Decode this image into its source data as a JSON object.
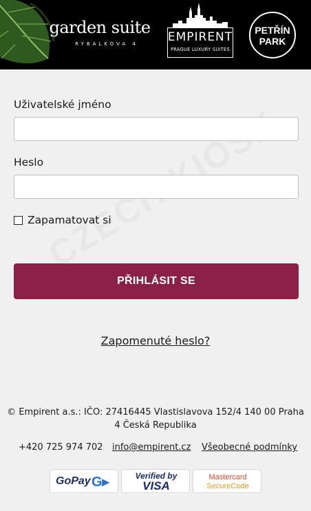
{
  "header": {
    "garden_suite": {
      "name": "garden suite",
      "sub": "RYBALKOVA 4"
    },
    "empirent": {
      "title": "EMPIRENT",
      "tagline": "PRAGUE LUXURY SUITES"
    },
    "petrin": {
      "line1": "PETŘÍN",
      "line2": "PARK"
    }
  },
  "watermark": "CZECH KIOSK",
  "form": {
    "username_label": "Uživatelské jméno",
    "username_value": "",
    "password_label": "Heslo",
    "password_value": "",
    "remember_label": "Zapamatovat si",
    "remember_checked": false,
    "login_button": "PŘIHLÁSIT SE",
    "forgot_link": "Zapomenuté heslo?"
  },
  "footer": {
    "company_line": "© Empirent a.s.: IČO: 27416445 Vlastislavova 152/4 140 00 Praha 4 Česká Republika",
    "phone": "+420 725 974 702",
    "email": "info@empirent.cz",
    "terms": "Všeobecné podmínky",
    "payments": {
      "gopay": "GoPay",
      "visa_line1": "Verified by",
      "visa_line2": "VISA",
      "mc_line1": "Mastercard",
      "mc_line2": "SecureCode"
    }
  },
  "colors": {
    "accent": "#8a2047",
    "header_bg": "#000000",
    "page_bg": "#f0f0f0"
  }
}
